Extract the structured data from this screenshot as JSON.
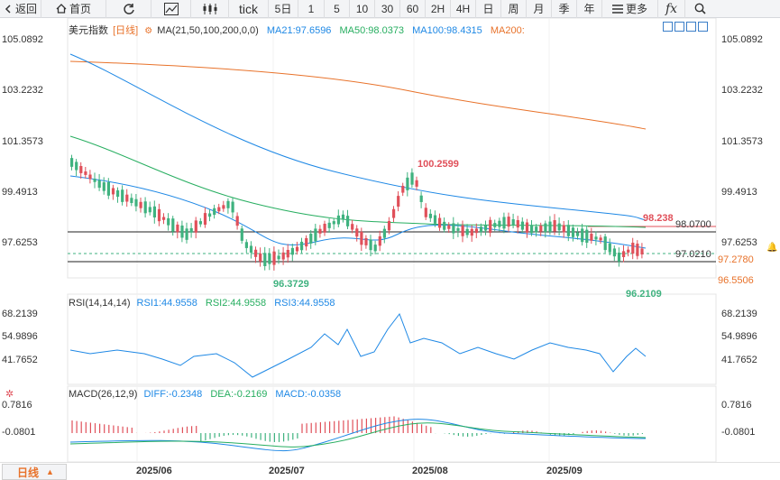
{
  "toolbar": {
    "back": "返回",
    "home": "首页",
    "tick": "tick",
    "periods": [
      "5日",
      "1",
      "5",
      "10",
      "30",
      "60",
      "2H",
      "4H",
      "日",
      "周",
      "月",
      "季",
      "年"
    ],
    "more": "更多"
  },
  "header": {
    "name": "美元指数",
    "period": "[日线]",
    "ma_label": "MA(21,50,100,200,0,0)",
    "ma21": "MA21:97.6596",
    "ma50": "MA50:98.0373",
    "ma100": "MA100:98.4315",
    "ma200": "MA200:"
  },
  "y_axis_main": [
    "105.0892",
    "103.2232",
    "101.3573",
    "99.4913",
    "97.6253"
  ],
  "y_axis_rsi": [
    "68.2139",
    "54.9896",
    "41.7652"
  ],
  "y_axis_macd": [
    "0.7816",
    "-0.0801"
  ],
  "annotations": {
    "high": "100.2599",
    "low1": "96.3729",
    "low2": "96.2109",
    "red_line": "98.238",
    "line1": "98.0700",
    "line2": "97.0210",
    "current": "97.2780",
    "line3": "96.5506"
  },
  "rsi": {
    "label": "RSI(14,14,14)",
    "rsi1": "RSI1:44.9558",
    "rsi2": "RSI2:44.9558",
    "rsi3": "RSI3:44.9558"
  },
  "macd": {
    "label": "MACD(26,12,9)",
    "diff": "DIFF:-0.2348",
    "dea": "DEA:-0.2169",
    "macd": "MACD:-0.0358"
  },
  "x_axis": [
    "2025/06",
    "2025/07",
    "2025/08",
    "2025/09"
  ],
  "period_button": "日线",
  "colors": {
    "up": "#e0505a",
    "down": "#3fb27f",
    "ma21": "#1e88e5",
    "ma50": "#27ae60",
    "ma100": "#1e88e5",
    "ma200": "#e8722a",
    "accent": "#e8722a"
  }
}
